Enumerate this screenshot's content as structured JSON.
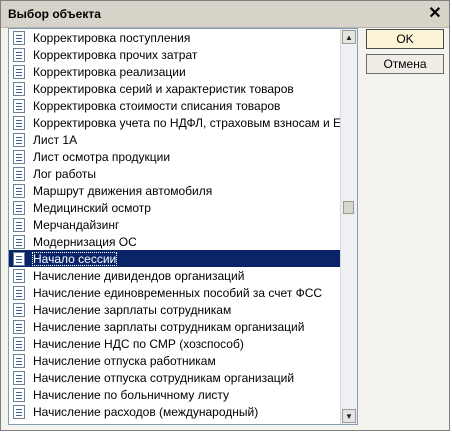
{
  "window": {
    "title": "Выбор объекта"
  },
  "buttons": {
    "ok": "OK",
    "cancel": "Отмена"
  },
  "list": {
    "selected_index": 13,
    "items": [
      "Корректировка поступления",
      "Корректировка прочих затрат",
      "Корректировка реализации",
      "Корректировка серий и характеристик товаров",
      "Корректировка стоимости списания товаров",
      "Корректировка учета по НДФЛ, страховым взносам и ЕСН",
      "Лист 1А",
      "Лист осмотра продукции",
      "Лог работы",
      "Маршрут движения автомобиля",
      "Медицинский осмотр",
      "Мерчандайзинг",
      "Модернизация ОС",
      "Начало сессии",
      "Начисление дивидендов организаций",
      "Начисление единовременных пособий за счет ФСС",
      "Начисление зарплаты сотрудникам",
      "Начисление зарплаты сотрудникам организаций",
      "Начисление НДС по СМР (хозспособ)",
      "Начисление отпуска работникам",
      "Начисление отпуска сотрудникам организаций",
      "Начисление по больничному листу",
      "Начисление расходов (международный)"
    ]
  },
  "icons": {
    "item": "document-list-icon",
    "close": "close-icon",
    "scroll_up": "arrow-up-icon",
    "scroll_down": "arrow-down-icon"
  }
}
